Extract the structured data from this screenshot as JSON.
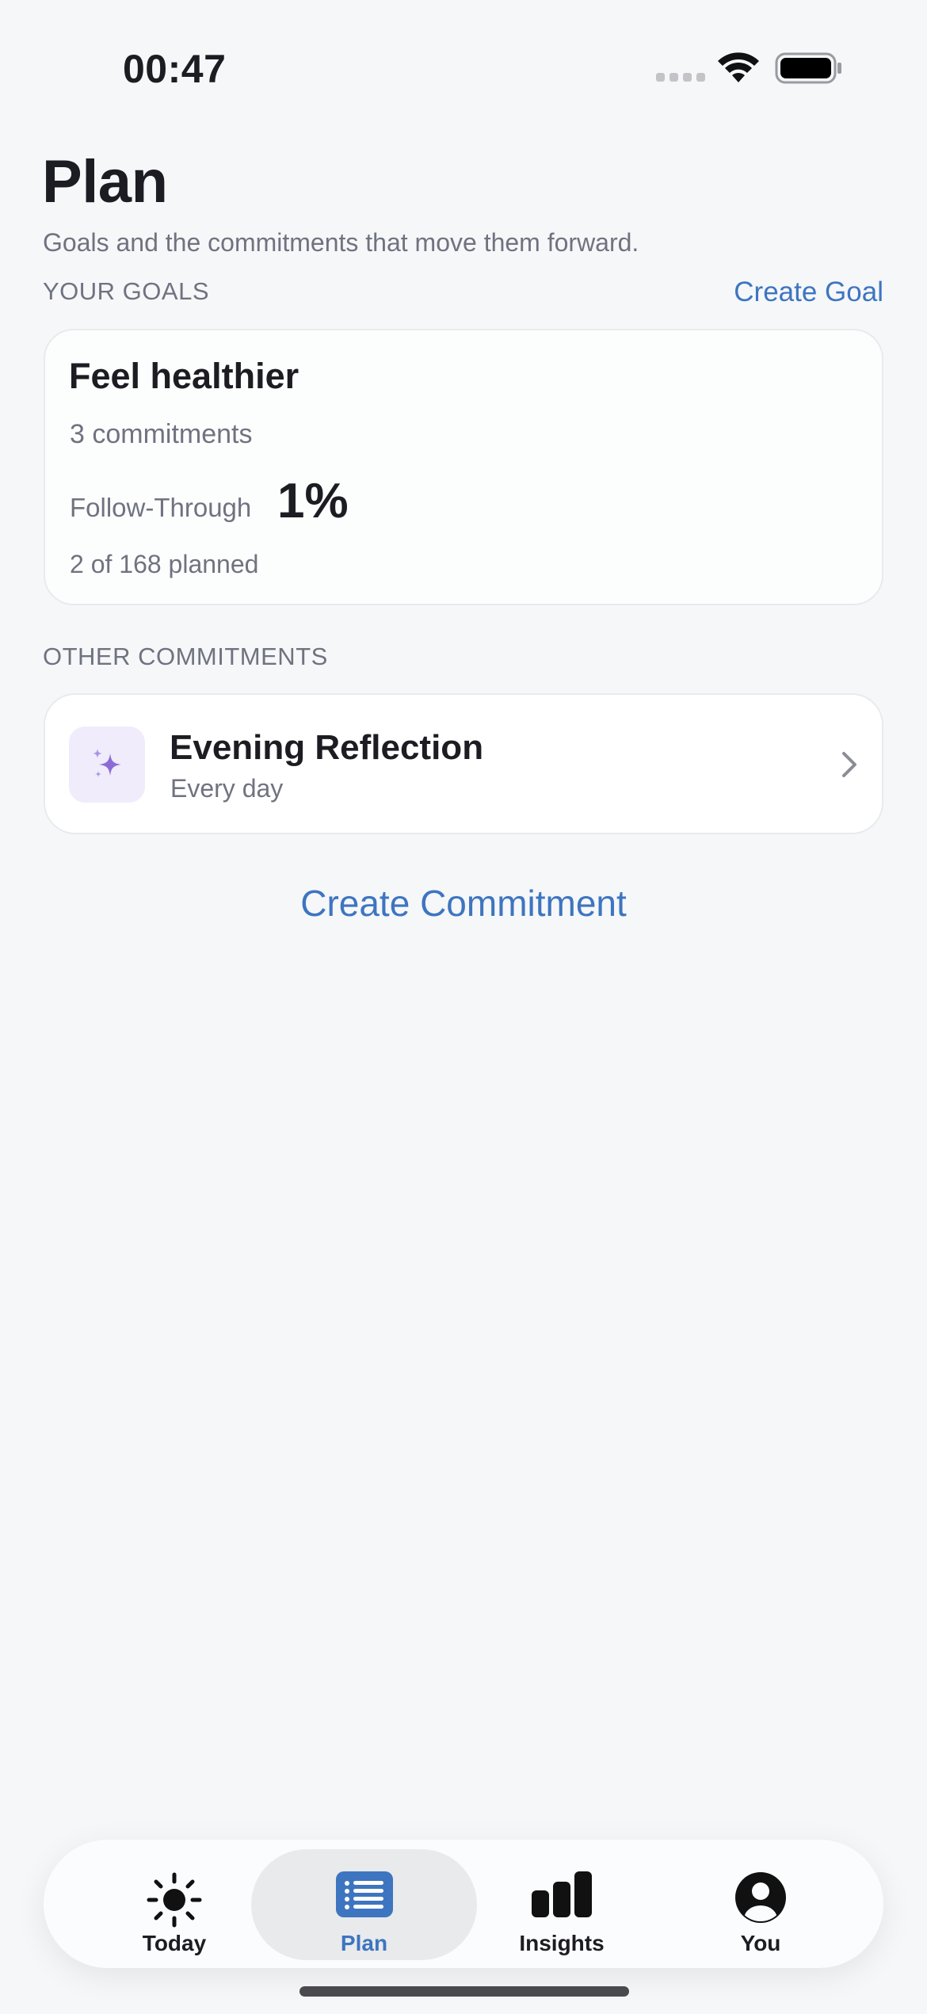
{
  "status_bar": {
    "time": "00:47"
  },
  "header": {
    "title": "Plan",
    "subtitle": "Goals and the commitments that move them forward."
  },
  "goals_section": {
    "label": "YOUR GOALS",
    "create_label": "Create Goal",
    "goals": [
      {
        "title": "Feel healthier",
        "commitments": "3 commitments",
        "follow_through_label": "Follow-Through",
        "follow_through_value": "1%",
        "planned": "2 of 168 planned"
      }
    ]
  },
  "other_section": {
    "label": "OTHER COMMITMENTS",
    "commitments": [
      {
        "title": "Evening Reflection",
        "schedule": "Every day",
        "icon": "sparkles-icon",
        "icon_color": "#8b6cd6"
      }
    ]
  },
  "create_commitment_label": "Create Commitment",
  "tab_bar": {
    "active": "Plan",
    "accent_color": "#3d75c0",
    "tabs": [
      {
        "label": "Today",
        "icon": "sun-icon"
      },
      {
        "label": "Plan",
        "icon": "list-icon"
      },
      {
        "label": "Insights",
        "icon": "bar-chart-icon"
      },
      {
        "label": "You",
        "icon": "person-icon"
      }
    ]
  }
}
